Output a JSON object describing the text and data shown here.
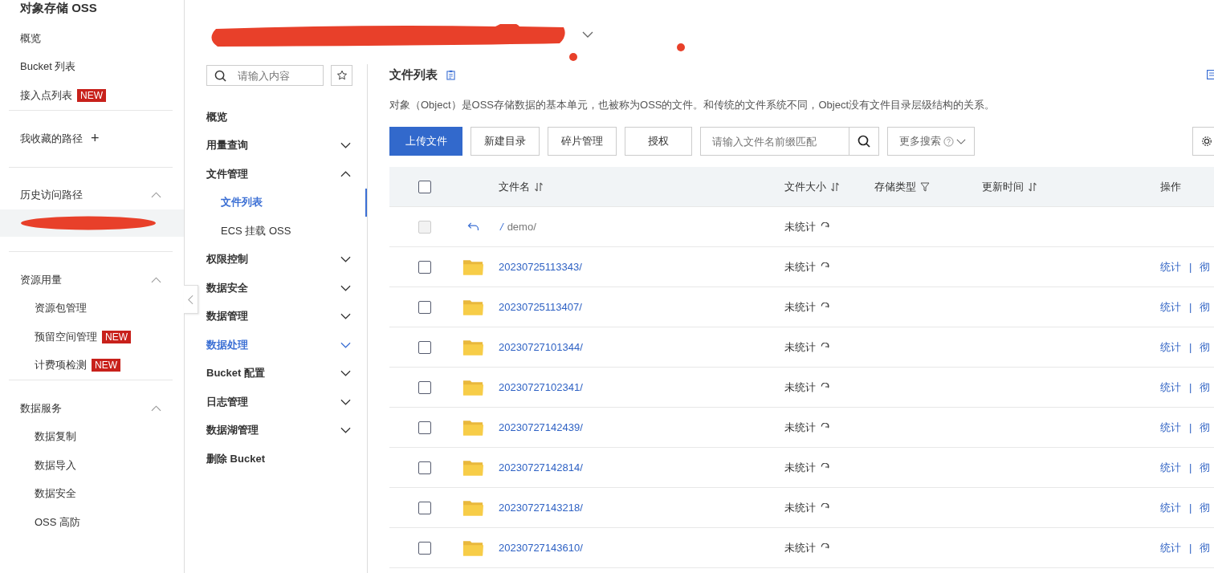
{
  "sidebar": {
    "title": "对象存储 OSS",
    "top_items": [
      {
        "label": "概览"
      },
      {
        "label": "Bucket 列表"
      },
      {
        "label": "接入点列表",
        "badge": "NEW"
      }
    ],
    "favorites": {
      "label": "我收藏的路径",
      "add_icon": "+"
    },
    "groups": [
      {
        "label": "历史访问路径",
        "expanded": true,
        "children": [
          {
            "kind": "redacted"
          }
        ]
      },
      {
        "label": "资源用量",
        "expanded": true,
        "children": [
          {
            "kind": "link",
            "label": "资源包管理"
          },
          {
            "kind": "link",
            "label": "预留空间管理",
            "badge": "NEW"
          },
          {
            "kind": "link",
            "label": "计费项检测",
            "badge": "NEW"
          }
        ]
      },
      {
        "label": "数据服务",
        "expanded": true,
        "children": [
          {
            "kind": "link",
            "label": "数据复制"
          },
          {
            "kind": "link",
            "label": "数据导入"
          },
          {
            "kind": "link",
            "label": "数据安全"
          },
          {
            "kind": "link",
            "label": "OSS 高防"
          }
        ]
      }
    ]
  },
  "nav": {
    "search": {
      "placeholder": "请输入内容"
    },
    "items": [
      {
        "label": "概览",
        "highlighted": false
      },
      {
        "label": "用量查询",
        "highlighted": false,
        "expanded": false
      },
      {
        "label": "文件管理",
        "highlighted": false,
        "expanded": true,
        "children": [
          {
            "label": "文件列表",
            "selected": true
          },
          {
            "label": "ECS 挂载 OSS",
            "selected": false
          }
        ]
      },
      {
        "label": "权限控制",
        "highlighted": false,
        "expanded": false
      },
      {
        "label": "数据安全",
        "highlighted": false,
        "expanded": false
      },
      {
        "label": "数据管理",
        "highlighted": false,
        "expanded": false
      },
      {
        "label": "数据处理",
        "highlighted": true,
        "expanded": false
      },
      {
        "label": "Bucket 配置",
        "highlighted": false,
        "expanded": false
      },
      {
        "label": "日志管理",
        "highlighted": false,
        "expanded": false
      },
      {
        "label": "数据湖管理",
        "highlighted": false,
        "expanded": false
      },
      {
        "label": "删除 Bucket",
        "highlighted": false
      }
    ]
  },
  "main": {
    "title": "文件列表",
    "description": "对象（Object）是OSS存储数据的基本单元，也被称为OSS的文件。和传统的文件系统不同，Object没有文件目录层级结构的关系。",
    "buttons": [
      {
        "label": "上传文件",
        "kind": "primary"
      },
      {
        "label": "新建目录",
        "kind": "default"
      },
      {
        "label": "碎片管理",
        "kind": "default"
      },
      {
        "label": "授权",
        "kind": "default"
      }
    ],
    "search": {
      "placeholder": "请输入文件名前缀匹配"
    },
    "more_search": {
      "label": "更多搜索"
    },
    "table": {
      "columns": [
        {
          "label": "文件名",
          "kind": "sort"
        },
        {
          "label": "文件大小",
          "kind": "sort"
        },
        {
          "label": "存储类型",
          "kind": "filter"
        },
        {
          "label": "更新时间",
          "kind": "sort"
        },
        {
          "label": "操作",
          "kind": "plain"
        }
      ],
      "header_checked": false,
      "action_separator": "|",
      "rows": [
        {
          "kind": "parent",
          "prefix": "/",
          "name": "demo/",
          "size": "未统计",
          "disabled": true
        },
        {
          "kind": "folder",
          "name": "20230725113343/",
          "size": "未统计",
          "checked": false,
          "disabled": false,
          "actions": [
            "统计",
            "彻"
          ]
        },
        {
          "kind": "folder",
          "name": "20230725113407/",
          "size": "未统计",
          "checked": false,
          "disabled": false,
          "actions": [
            "统计",
            "彻"
          ]
        },
        {
          "kind": "folder",
          "name": "20230727101344/",
          "size": "未统计",
          "checked": false,
          "disabled": false,
          "actions": [
            "统计",
            "彻"
          ]
        },
        {
          "kind": "folder",
          "name": "20230727102341/",
          "size": "未统计",
          "checked": false,
          "disabled": false,
          "actions": [
            "统计",
            "彻"
          ]
        },
        {
          "kind": "folder",
          "name": "20230727142439/",
          "size": "未统计",
          "checked": false,
          "disabled": false,
          "actions": [
            "统计",
            "彻"
          ]
        },
        {
          "kind": "folder",
          "name": "20230727142814/",
          "size": "未统计",
          "checked": false,
          "disabled": false,
          "actions": [
            "统计",
            "彻"
          ]
        },
        {
          "kind": "folder",
          "name": "20230727143218/",
          "size": "未统计",
          "checked": false,
          "disabled": false,
          "actions": [
            "统计",
            "彻"
          ]
        },
        {
          "kind": "folder",
          "name": "20230727143610/",
          "size": "未统计",
          "checked": false,
          "disabled": false,
          "actions": [
            "统计",
            "彻"
          ]
        }
      ]
    }
  }
}
